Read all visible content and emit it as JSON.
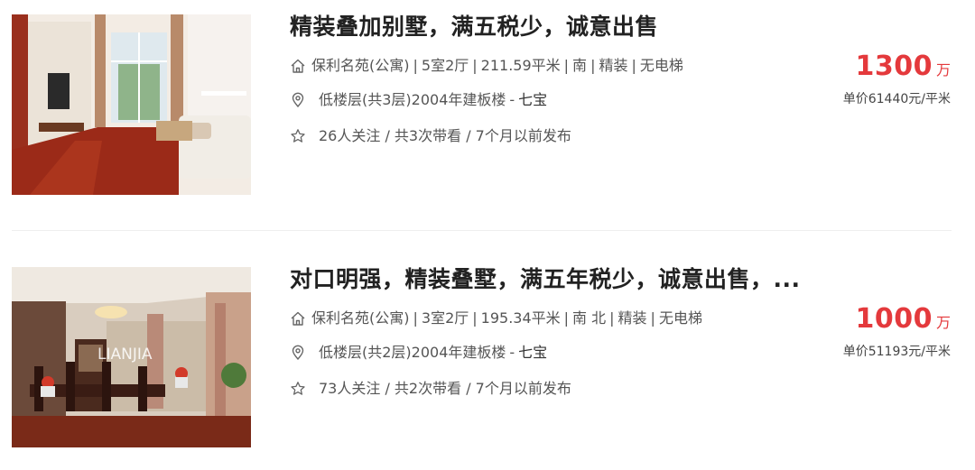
{
  "listings": [
    {
      "title": "精装叠加别墅，满五税少，诚意出售",
      "community": "保利名苑(公寓)",
      "layout": "5室2厅",
      "area": "211.59平米",
      "orientation": "南",
      "decoration": "精装",
      "elevator": "无电梯",
      "floor": "低楼层(共3层)2004年建板楼",
      "location": "七宝",
      "follow": "26人关注 / 共3次带看 / 7个月以前发布",
      "total_price": "1300",
      "price_unit": "万",
      "unit_price": "单价61440元/平米",
      "house_icon": "house-icon",
      "pin_icon": "location-pin-icon",
      "star_icon": "star-icon"
    },
    {
      "title": "对口明强，精装叠墅，满五年税少，诚意出售，...",
      "community": "保利名苑(公寓)",
      "layout": "3室2厅",
      "area": "195.34平米",
      "orientation": "南 北",
      "decoration": "精装",
      "elevator": "无电梯",
      "floor": "低楼层(共2层)2004年建板楼",
      "location": "七宝",
      "follow": "73人关注 / 共2次带看 / 7个月以前发布",
      "total_price": "1000",
      "price_unit": "万",
      "unit_price": "单价51193元/平米",
      "watermark": "LIANJIA",
      "house_icon": "house-icon",
      "pin_icon": "location-pin-icon",
      "star_icon": "star-icon"
    }
  ],
  "separator": "|",
  "dash": "-",
  "colors": {
    "price": "#e4393c",
    "title": "#222222",
    "meta": "#555555",
    "divider": "#eeeeee"
  }
}
